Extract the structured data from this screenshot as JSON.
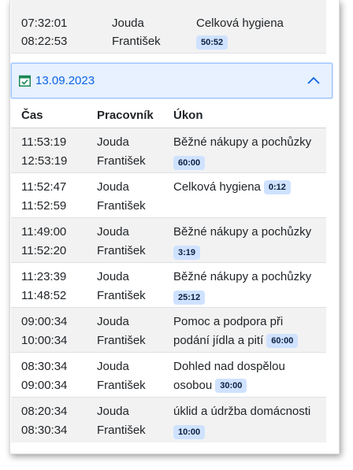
{
  "top_row": {
    "time_start": "07:32:01",
    "time_end": "08:22:53",
    "worker_first": "Jouda",
    "worker_second": "František",
    "task": "Celková hygiena",
    "duration": "50:52"
  },
  "group": {
    "date": "13.09.2023",
    "icon": "calendar-check-icon",
    "toggle_icon": "chevron-up-icon"
  },
  "columns": {
    "time": "Čas",
    "worker": "Pracovník",
    "task": "Úkon"
  },
  "rows": [
    {
      "time_start": "11:53:19",
      "time_end": "12:53:19",
      "worker_first": "Jouda",
      "worker_second": "František",
      "task_line1": "Běžné nákupy a pochůzky",
      "task_line2": "",
      "duration": "60:00"
    },
    {
      "time_start": "11:52:47",
      "time_end": "11:52:59",
      "worker_first": "Jouda",
      "worker_second": "František",
      "task_line1": "Celková hygiena",
      "task_line2": "",
      "duration": "0:12"
    },
    {
      "time_start": "11:49:00",
      "time_end": "11:52:20",
      "worker_first": "Jouda",
      "worker_second": "František",
      "task_line1": "Běžné nákupy a pochůzky",
      "task_line2": "",
      "duration": "3:19"
    },
    {
      "time_start": "11:23:39",
      "time_end": "11:48:52",
      "worker_first": "Jouda",
      "worker_second": "František",
      "task_line1": "Běžné nákupy a pochůzky",
      "task_line2": "",
      "duration": "25:12"
    },
    {
      "time_start": "09:00:34",
      "time_end": "10:00:34",
      "worker_first": "Jouda",
      "worker_second": "František",
      "task_line1": "Pomoc a podpora při",
      "task_line2": "podání jídla a pití",
      "duration": "60:00"
    },
    {
      "time_start": "08:30:34",
      "time_end": "09:00:34",
      "worker_first": "Jouda",
      "worker_second": "František",
      "task_line1": "Dohled nad dospělou",
      "task_line2": "osobou",
      "duration": "30:00"
    },
    {
      "time_start": "08:20:34",
      "time_end": "08:30:34",
      "worker_first": "Jouda",
      "worker_second": "František",
      "task_line1": "úklid a údržba domácnosti",
      "task_line2": "",
      "duration": "10:00"
    }
  ],
  "colors": {
    "row_shaded": "#f2f2f2",
    "badge_bg": "#cfe2ff",
    "header_bg": "#e7f1ff",
    "header_border": "#9ec5fe",
    "accent": "#0c63e4",
    "icon_green": "#198754"
  }
}
